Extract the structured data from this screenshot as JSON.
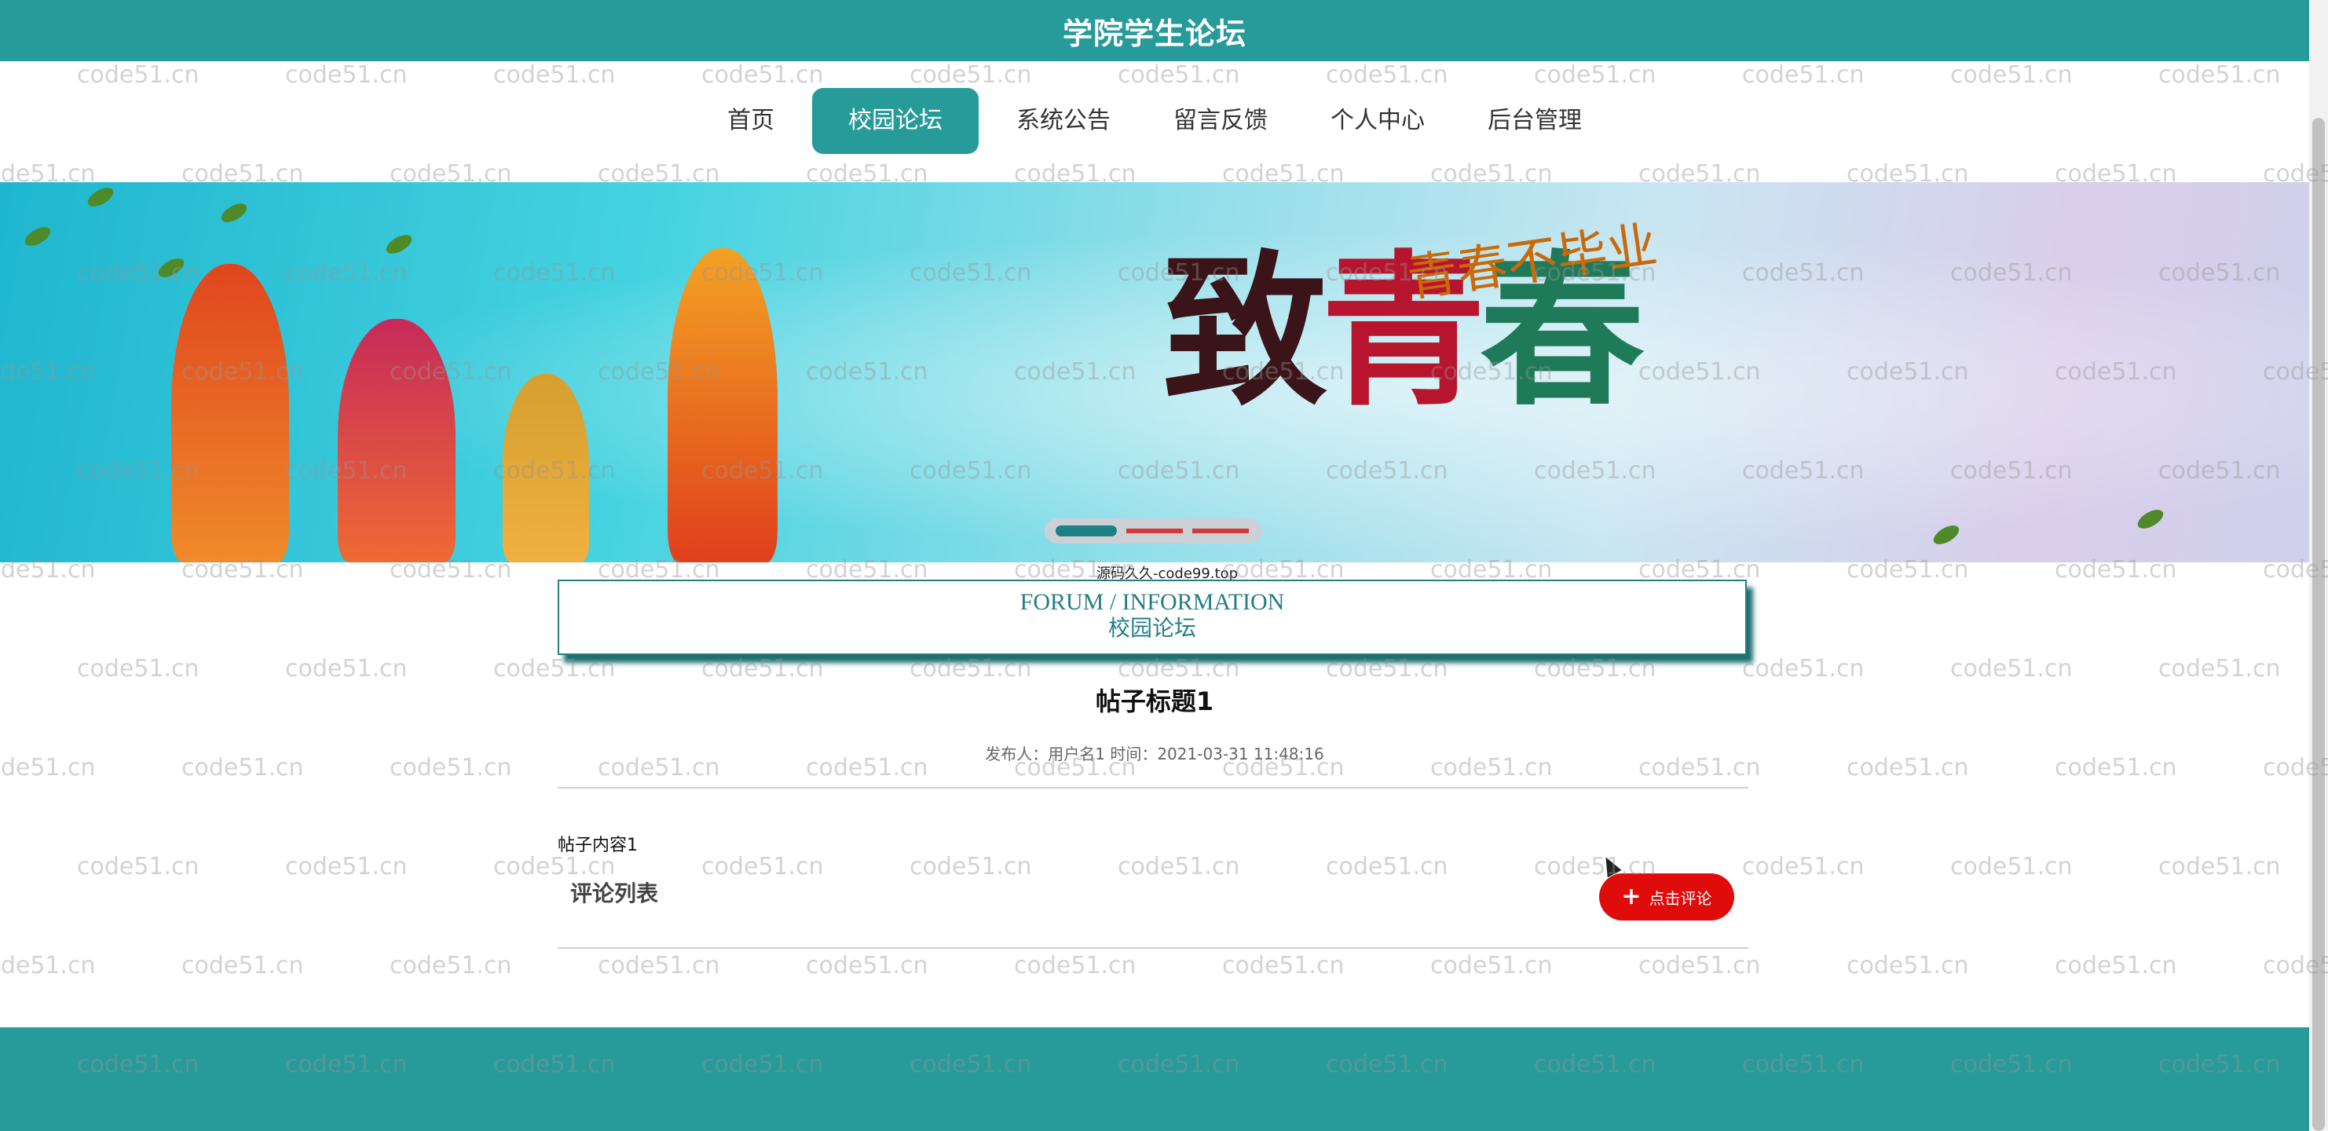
{
  "header": {
    "title": "学院学生论坛"
  },
  "nav": {
    "items": [
      "首页",
      "校园论坛",
      "系统公告",
      "留言反馈",
      "个人中心",
      "后台管理"
    ],
    "active": "校园论坛"
  },
  "banner": {
    "title_chars": [
      "致",
      "青",
      "春"
    ],
    "subtitle": "青春不毕业",
    "slides": 3,
    "active_slide": 1
  },
  "source_note": "源码久久-code99.top",
  "section": {
    "en": "FORUM / INFORMATION",
    "cn": "校园论坛"
  },
  "post": {
    "title": "帖子标题1",
    "meta": "发布人：用户名1 时间：2021-03-31 11:48:16",
    "content": "帖子内容1"
  },
  "comments": {
    "title": "评论列表",
    "button_label": "点击评论"
  },
  "watermark": "code51.cn",
  "colors": {
    "primary": "#279a9a",
    "accent_red": "#e00b0b",
    "text_dark": "#111111"
  },
  "icons": {
    "comment_button": "plus-icon"
  }
}
